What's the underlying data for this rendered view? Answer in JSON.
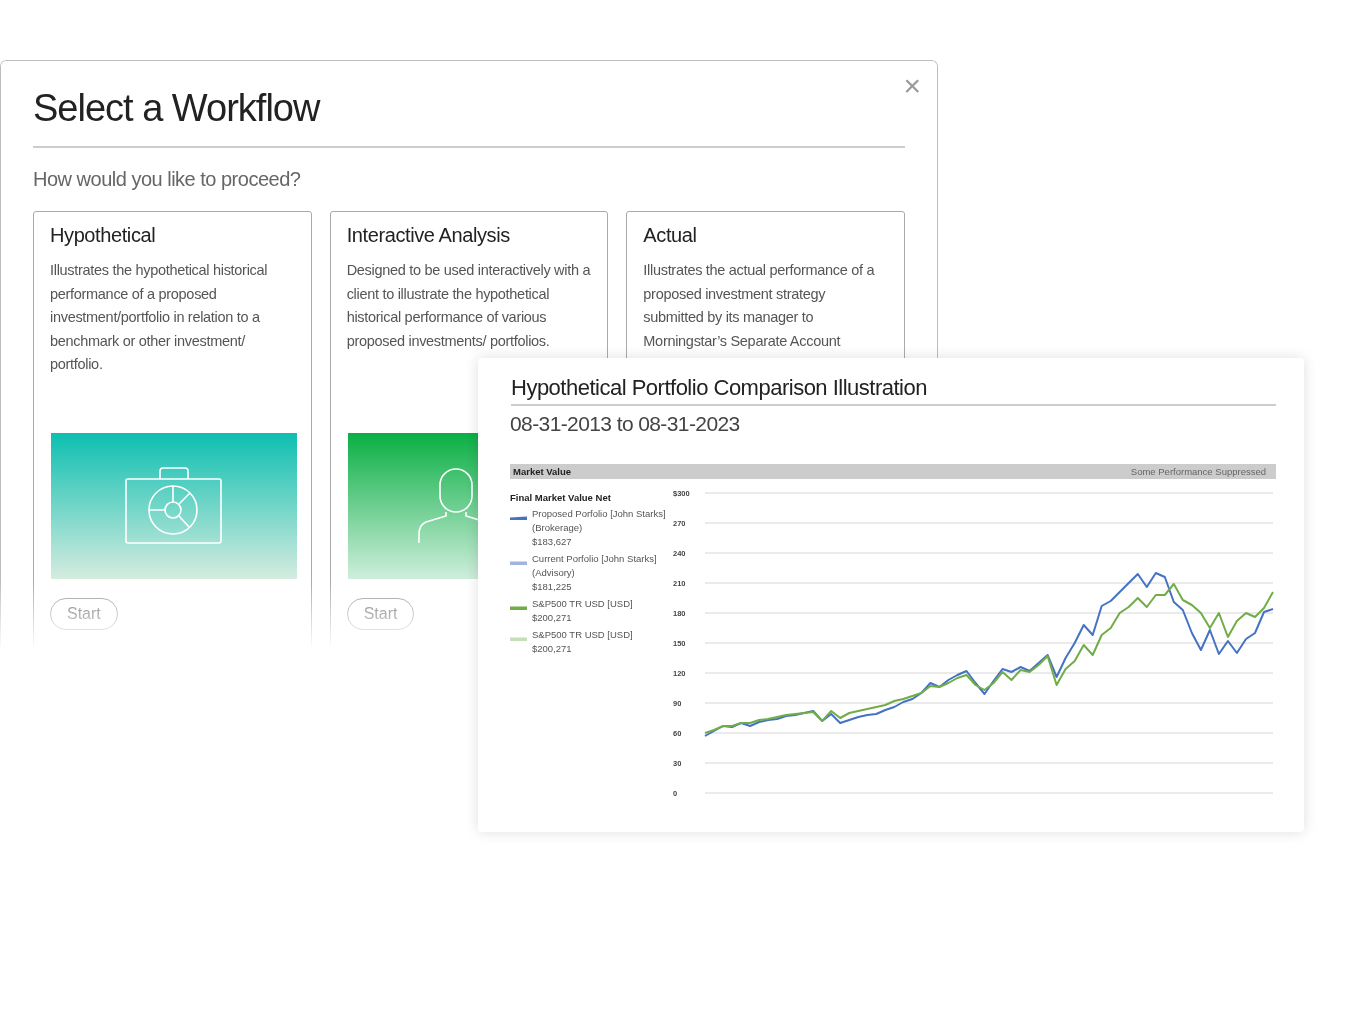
{
  "dialog": {
    "title": "Select a Workflow",
    "close": "×",
    "subtitle": "How would you like to proceed?",
    "cards": [
      {
        "title": "Hypothetical",
        "description": "Illustrates the hypothetical historical performance of a proposed investment/portfolio in relation to a benchmark or other investment/ portfolio.",
        "kind": "briefcase",
        "button": "Start"
      },
      {
        "title": "Interactive Analysis",
        "description": "Designed to be used interactively with a client to illustrate the hypothetical historical performance of various proposed investments/ portfolios.",
        "kind": "person",
        "button": "Start"
      },
      {
        "title": "Actual",
        "description": "Illustrates the actual performance of a proposed investment strategy submitted by its manager to Morningstar’s Separate Account"
      }
    ]
  },
  "report": {
    "title": "Hypothetical Portfolio Comparison Illustration",
    "date_range": "08-31-2013 to 08-31-2023",
    "section": {
      "title": "Market Value",
      "note": "Some Performance Suppressed"
    },
    "legend": {
      "title": "Final Market Value Net",
      "items": [
        {
          "name": "Proposed Porfolio [John Starks] (Brokerage)",
          "value": "$183,627",
          "color": "#4472c4",
          "kind": "slant"
        },
        {
          "name": "Current Porfolio [John Starks] (Advisory)",
          "value": "$181,225",
          "color": "#9fb5dd",
          "kind": "bar"
        },
        {
          "name": "S&P500 TR USD [USD]",
          "value": "$200,271",
          "color": "#70ad47",
          "kind": "bar"
        },
        {
          "name": "S&P500 TR USD [USD]",
          "value": "$200,271",
          "color": "#c5e0b4",
          "kind": "bar"
        }
      ]
    },
    "chart_data": {
      "type": "line",
      "grid": true,
      "ylim": [
        0,
        300
      ],
      "yticks": [
        0,
        30,
        60,
        90,
        120,
        150,
        180,
        210,
        240,
        270,
        {
          "value": 300,
          "label": "$300"
        }
      ],
      "series": [
        {
          "color": "#4472c4",
          "values": [
            57,
            62,
            67,
            66,
            70,
            67,
            71,
            73,
            74,
            77,
            78,
            80,
            82,
            72,
            79,
            70,
            73,
            76,
            78,
            79,
            83,
            86,
            91,
            94,
            100,
            110,
            106,
            113,
            118,
            122,
            110,
            99,
            112,
            124,
            121,
            126,
            122,
            130,
            138,
            116,
            135,
            150,
            168,
            158,
            187,
            192,
            201,
            210,
            219,
            206,
            220,
            216,
            191,
            183,
            160,
            143,
            163,
            139,
            152,
            140,
            154,
            160,
            181,
            184
          ]
        },
        {
          "color": "#70ad47",
          "values": [
            60,
            63,
            67,
            67,
            70,
            70,
            73,
            74,
            76,
            78,
            79,
            80,
            81,
            72,
            82,
            75,
            80,
            82,
            84,
            86,
            88,
            92,
            94,
            97,
            100,
            107,
            106,
            110,
            115,
            118,
            108,
            103,
            110,
            121,
            113,
            123,
            121,
            128,
            137,
            108,
            124,
            132,
            148,
            138,
            158,
            165,
            180,
            186,
            195,
            186,
            198,
            198,
            209,
            193,
            188,
            180,
            165,
            180,
            156,
            172,
            180,
            176,
            185,
            201
          ]
        }
      ]
    }
  }
}
